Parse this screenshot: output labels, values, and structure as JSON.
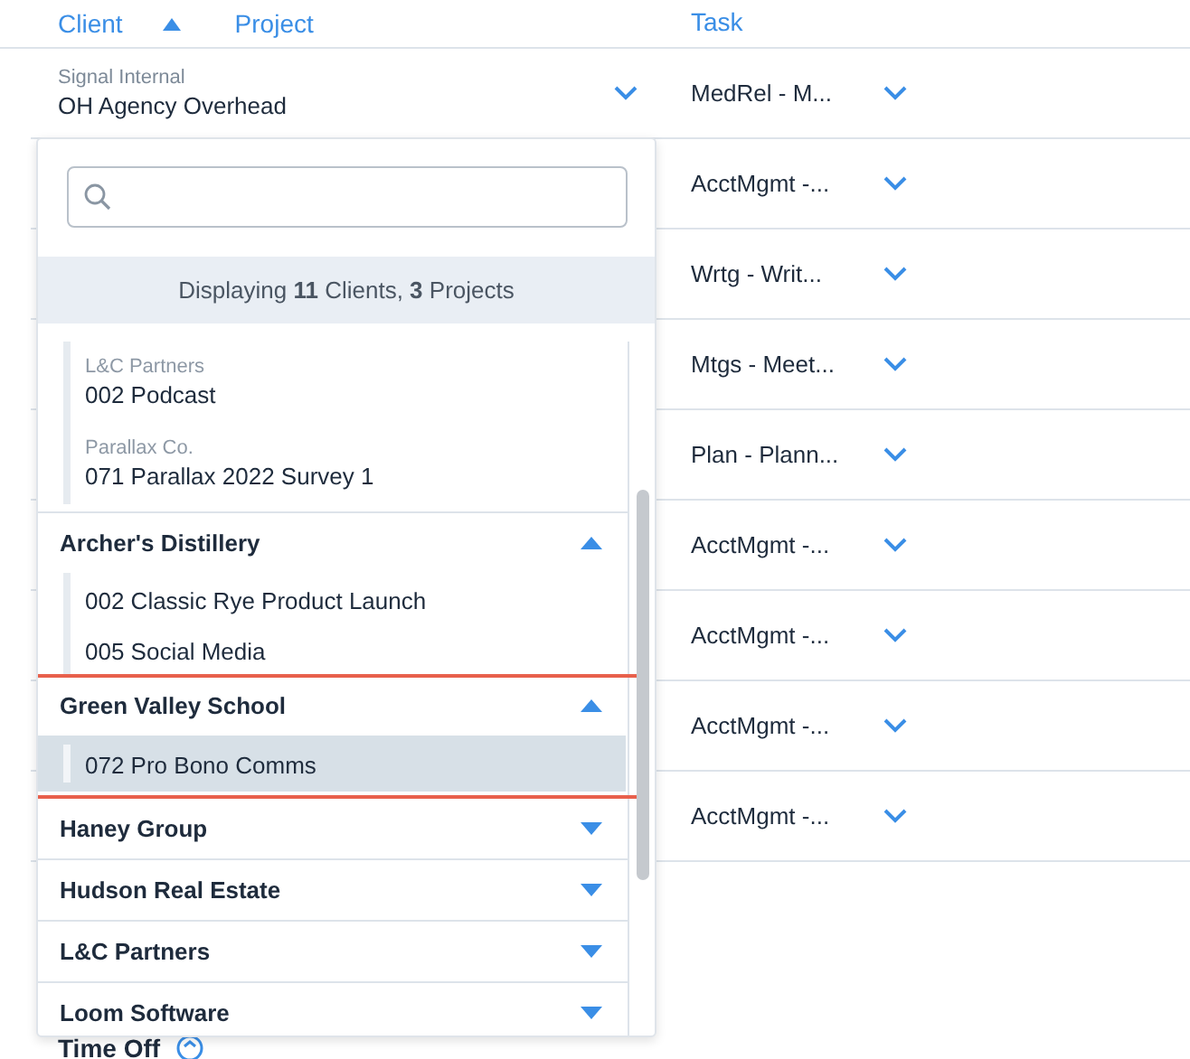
{
  "columns": [
    {
      "label": "Client",
      "sorted": true
    },
    {
      "label": "Project",
      "sorted": false
    },
    {
      "label": "Task",
      "sorted": false
    }
  ],
  "rows": [
    {
      "client": "Signal Internal",
      "project": "OH Agency Overhead",
      "task": "MedRel - M..."
    },
    {
      "task": "AcctMgmt -..."
    },
    {
      "task": "Wrtg - Writ..."
    },
    {
      "task": "Mtgs - Meet..."
    },
    {
      "task": "Plan - Plann..."
    },
    {
      "task": "AcctMgmt -..."
    },
    {
      "task": "AcctMgmt -..."
    },
    {
      "task": "AcctMgmt -..."
    },
    {
      "task": "AcctMgmt -..."
    }
  ],
  "section_label": "Time Off",
  "dropdown": {
    "summary": "Displaying **11** Clients, **3** Projects",
    "groups": [
      {
        "kind": "results",
        "projects": [
          {
            "client": "L&C Partners",
            "name": "002 Podcast",
            "selected": false
          },
          {
            "client": "Parallax Co.",
            "name": "071 Parallax 2022 Survey 1",
            "selected": false
          }
        ]
      },
      {
        "kind": "client",
        "name": "Archer's Distillery",
        "expanded": true,
        "highlighted": false,
        "projects": [
          {
            "name": "002 Classic Rye Product Launch",
            "selected": false
          },
          {
            "name": "005 Social Media",
            "selected": false
          }
        ]
      },
      {
        "kind": "client",
        "name": "Green Valley School",
        "expanded": true,
        "highlighted": true,
        "projects": [
          {
            "name": "072 Pro Bono Comms",
            "selected": true
          }
        ]
      },
      {
        "kind": "client",
        "name": "Haney Group",
        "expanded": false,
        "highlighted": false
      },
      {
        "kind": "client",
        "name": "Hudson Real Estate",
        "expanded": false,
        "highlighted": false
      },
      {
        "kind": "client",
        "name": "L&C Partners",
        "expanded": false,
        "highlighted": false
      },
      {
        "kind": "client",
        "name": "Loom Software",
        "expanded": false,
        "highlighted": false
      }
    ]
  }
}
